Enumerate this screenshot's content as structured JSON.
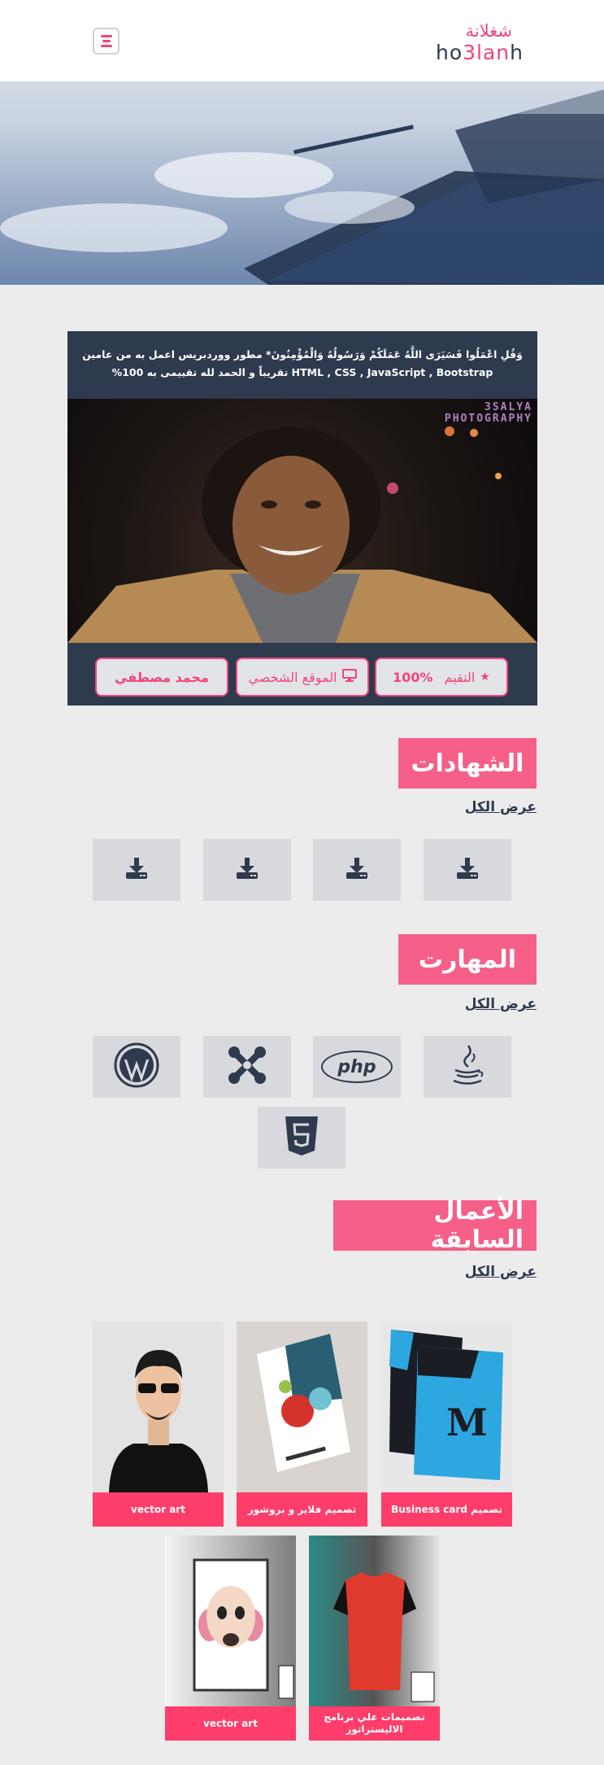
{
  "header": {
    "logo_ar": "شغلانة",
    "logo_en_part1": "ho",
    "logo_en_part2": "3lan",
    "logo_en_part3": "h"
  },
  "profile": {
    "bio": "وَقُلِ اعْمَلُوا فَسَيَرَى اللَّهُ عَمَلَكُمْ وَرَسُولُهُ وَالْمُؤْمِنُونَ* مطور ووردبريس اعمل به من عامين HTML , CSS , JavaScript , Bootstrap تقريباً و الحمد لله تقييمى به 100%",
    "watermark_line1": "3SALYA",
    "watermark_line2": "PHOTOGRAPHY",
    "rating_label": "التقيم",
    "rating_value": "100%",
    "website_label": "الموقع الشخصي",
    "name": "محمد مصطفي"
  },
  "certificates": {
    "title": "الشهادات",
    "view_all": "عرض الكل"
  },
  "skills": {
    "title": "المهارت",
    "view_all": "عرض الكل",
    "php_label": "php"
  },
  "works": {
    "title": "الأعمال السابقة",
    "view_all": "عرض الكل",
    "items": [
      {
        "caption": "تصميم Business card"
      },
      {
        "caption": "تصميم فلاير و بروشور"
      },
      {
        "caption": "vector art"
      },
      {
        "caption": "تصميمات علي برنامج الاليستراتور"
      },
      {
        "caption": "vector art"
      }
    ]
  },
  "colors": {
    "accent": "#f0457a",
    "dark": "#2e3a4d",
    "caption_bg": "#ff3d6a"
  }
}
